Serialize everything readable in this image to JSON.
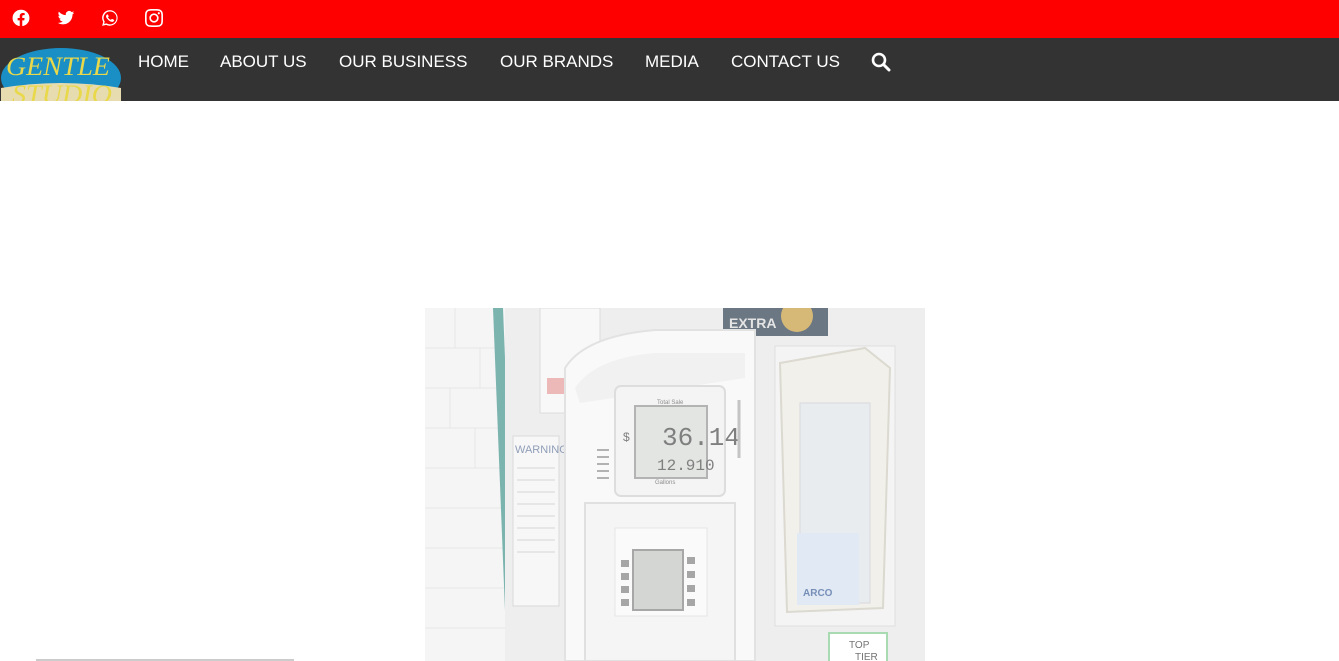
{
  "social": {
    "icons": [
      "facebook-icon",
      "twitter-icon",
      "whatsapp-icon",
      "instagram-icon"
    ]
  },
  "logo": {
    "line1": "GENTLE",
    "line2": "STUDIO"
  },
  "nav": {
    "items": [
      {
        "label": "HOME"
      },
      {
        "label": "ABOUT US"
      },
      {
        "label": "OUR BUSINESS"
      },
      {
        "label": "OUR BRANDS"
      },
      {
        "label": "MEDIA"
      },
      {
        "label": "CONTACT US"
      }
    ],
    "search_icon": "search-icon"
  },
  "hero": {
    "label_extra": "EXTRA",
    "warning": "WARNING",
    "display_label": "Total Sale",
    "amount_symbol": "$",
    "amount": "36.14",
    "volume": "12.910",
    "volume_label": "Gallons",
    "sticker": "ARCO",
    "top_tier_1": "TOP",
    "top_tier_2": "TIER"
  },
  "colors": {
    "topbar": "#ff0000",
    "navbar": "#333333",
    "nav_text": "#ffffff",
    "logo_blue": "#1a8fc6",
    "logo_yellow": "#e8d84a"
  }
}
